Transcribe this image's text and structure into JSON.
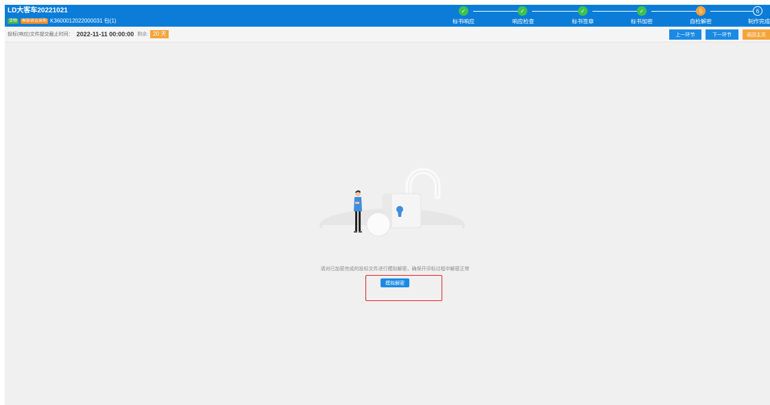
{
  "header": {
    "title": "LD大客车20221021",
    "tags": [
      "货物",
      "框架协议采购"
    ],
    "code": "K3600012022000031 包(1)"
  },
  "steps": [
    {
      "label": "标书响应",
      "status": "done"
    },
    {
      "label": "响应检查",
      "status": "done"
    },
    {
      "label": "标书签章",
      "status": "done"
    },
    {
      "label": "标书加密",
      "status": "done"
    },
    {
      "label": "自检解密",
      "status": "current",
      "number": "5"
    },
    {
      "label": "制作完成",
      "status": "todo",
      "number": "6"
    }
  ],
  "subbar": {
    "deadline_label": "投标(响应)文件提交截止时间：",
    "deadline_time": "2022-11-11 00:00:00",
    "remain_label": "剩余:",
    "remain_days": "20 天",
    "prev_label": "上一环节",
    "next_label": "下一环节",
    "home_label": "返回主页"
  },
  "main": {
    "hint": "请对已加密完成的投标文件进行模拟解密，确保开评标过程中解密正常",
    "decrypt_label": "模拟解密"
  },
  "colors": {
    "header_bg": "#0b7dd8",
    "step_done": "#3ec14d",
    "step_current": "#f4a13a",
    "button_blue": "#1a8ae5",
    "button_orange": "#f5a43a",
    "highlight": "#e02020"
  }
}
